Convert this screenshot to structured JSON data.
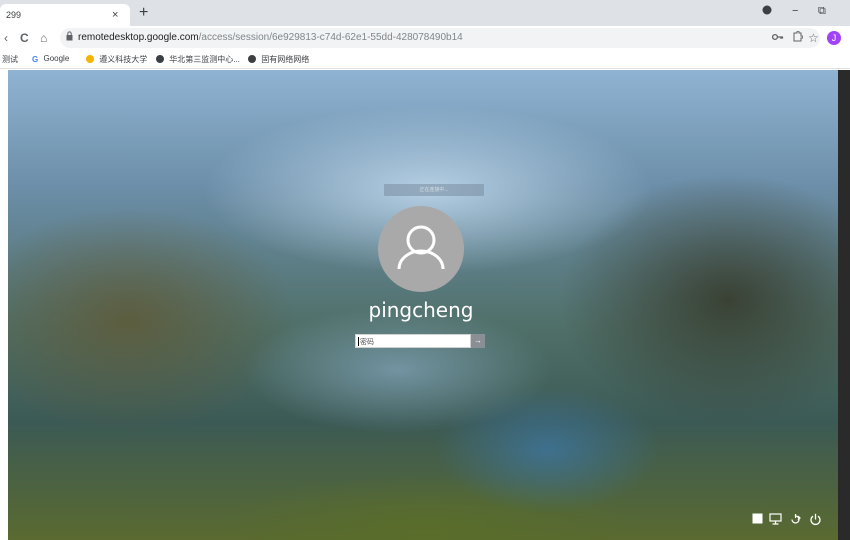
{
  "browser": {
    "tab": {
      "title": "299",
      "close_glyph": "×"
    },
    "new_tab_glyph": "+",
    "window_controls": [
      "−",
      "⧉"
    ],
    "nav": {
      "back_glyph": "‹",
      "reload_glyph": "C",
      "home_glyph": "⌂"
    },
    "address": {
      "host": "remotedesktop.google.com",
      "path": "/access/session/6e929813-c74d-62e1-55dd-428078490b14"
    },
    "toolbar_icons": [
      "key-icon",
      "extension-icon",
      "star-icon"
    ],
    "profile_initial": "J",
    "bookmarks": [
      {
        "label": "测试",
        "icon": "none"
      },
      {
        "label": "Google",
        "icon": "google-icon"
      },
      {
        "label": "遵义科技大学",
        "icon": "yellow-icon"
      },
      {
        "label": "华北第三监测中心...",
        "icon": "globe-icon"
      },
      {
        "label": "固有网络网络",
        "icon": "globe-icon"
      }
    ]
  },
  "lockscreen": {
    "status_text": "正在连接中...",
    "username": "pingcheng",
    "password_placeholder": "密码",
    "submit_glyph": "→",
    "system_icons": [
      "keyboard-icon",
      "network-icon",
      "accessibility-icon",
      "power-icon"
    ]
  },
  "colors": {
    "profile": "#a142f4",
    "avatar": "#a9a9a9",
    "submit": "#8a8f95"
  }
}
